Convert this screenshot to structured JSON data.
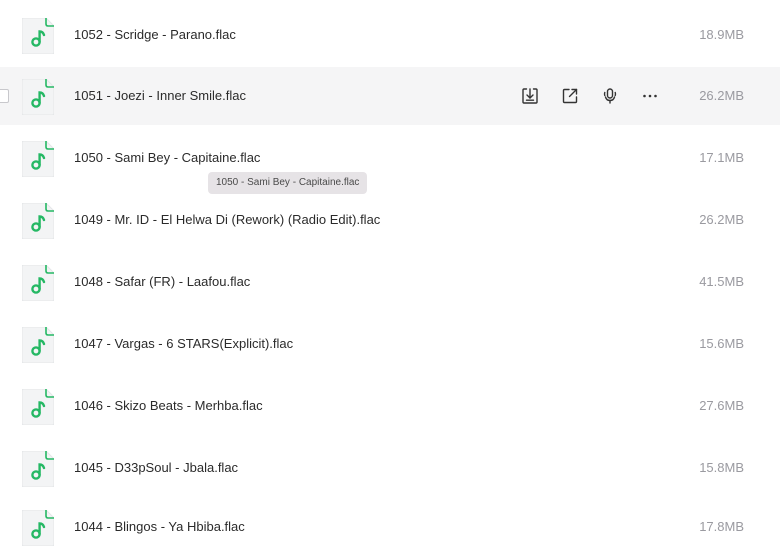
{
  "colors": {
    "icon_green": "#25b864",
    "hover_bg": "#f5f5f6",
    "text": "#2b2b2b",
    "size_text": "#9a9aa0"
  },
  "files": [
    {
      "name": "1052 - Scridge - Parano.flac",
      "size": "18.9MB",
      "icon": "music-file-icon"
    },
    {
      "name": "1051 - Joezi - Inner Smile.flac",
      "size": "26.2MB",
      "icon": "music-file-icon"
    },
    {
      "name": "1050 - Sami Bey - Capitaine.flac",
      "size": "17.1MB",
      "icon": "music-file-icon"
    },
    {
      "name": "1049 - Mr. ID - El Helwa Di (Rework) (Radio Edit).flac",
      "size": "26.2MB",
      "icon": "music-file-icon"
    },
    {
      "name": "1048 - Safar (FR) - Laafou.flac",
      "size": "41.5MB",
      "icon": "music-file-icon"
    },
    {
      "name": "1047 - Vargas - 6 STARS(Explicit).flac",
      "size": "15.6MB",
      "icon": "music-file-icon"
    },
    {
      "name": "1046 - Skizo Beats - Merhba.flac",
      "size": "27.6MB",
      "icon": "music-file-icon"
    },
    {
      "name": "1045 - D33pSoul - Jbala.flac",
      "size": "15.8MB",
      "icon": "music-file-icon"
    },
    {
      "name": "1044 - Blingos - Ya Hbiba.flac",
      "size": "17.8MB",
      "icon": "music-file-icon"
    }
  ],
  "hovered_row_actions": [
    "download-icon",
    "share-icon",
    "podcast-icon",
    "more-icon"
  ],
  "tooltip": {
    "text": "1050 - Sami Bey - Capitaine.flac"
  }
}
